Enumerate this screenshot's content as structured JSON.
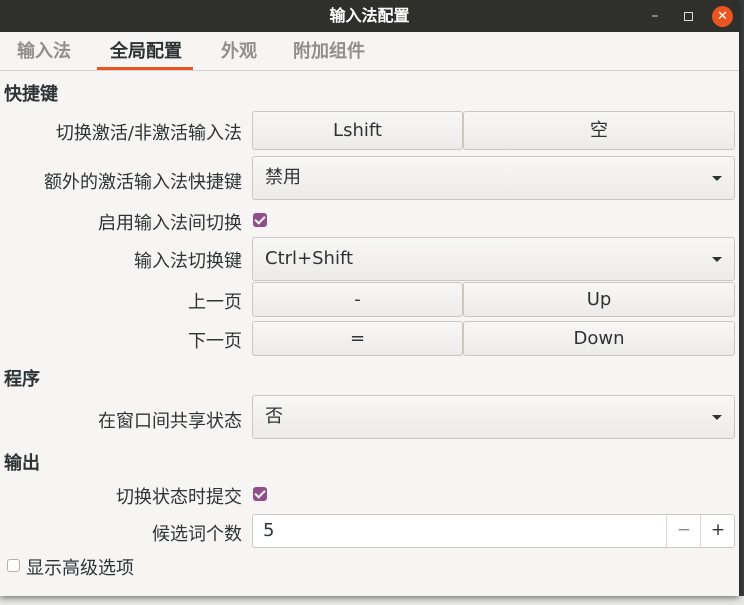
{
  "window": {
    "title": "输入法配置",
    "minimize_icon": "minimize-icon",
    "maximize_icon": "maximize-icon",
    "close_icon": "close-icon"
  },
  "tabs": [
    {
      "label": "输入法",
      "active": false
    },
    {
      "label": "全局配置",
      "active": true
    },
    {
      "label": "外观",
      "active": false
    },
    {
      "label": "附加组件",
      "active": false
    }
  ],
  "accent_color": "#e95420",
  "check_color": "#924d8b",
  "sections": {
    "hotkeys": {
      "heading": "快捷键",
      "toggle_im": {
        "label": "切换激活/非激活输入法",
        "key1": "Lshift",
        "key2": "空"
      },
      "extra_trigger": {
        "label": "额外的激活输入法快捷键",
        "value": "禁用"
      },
      "enable_switch": {
        "label": "启用输入法间切换",
        "checked": true
      },
      "switch_key": {
        "label": "输入法切换键",
        "value": "Ctrl+Shift"
      },
      "prev_page": {
        "label": "上一页",
        "key1": "-",
        "key2": "Up"
      },
      "next_page": {
        "label": "下一页",
        "key1": "=",
        "key2": "Down"
      }
    },
    "program": {
      "heading": "程序",
      "share_state": {
        "label": "在窗口间共享状态",
        "value": "否"
      }
    },
    "output": {
      "heading": "输出",
      "commit_on_switch": {
        "label": "切换状态时提交",
        "checked": true
      },
      "candidate_count": {
        "label": "候选词个数",
        "value": "5",
        "minus": "−",
        "plus": "+"
      }
    }
  },
  "show_advanced": {
    "label": "显示高级选项",
    "checked": false
  }
}
